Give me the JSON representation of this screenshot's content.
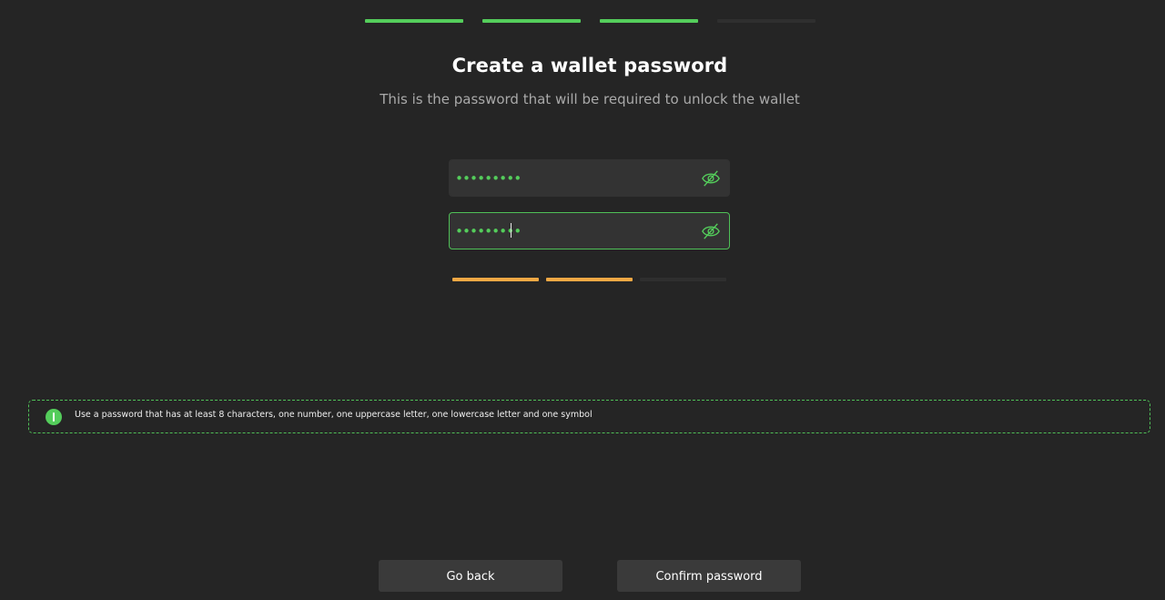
{
  "stepper": {
    "steps": [
      {
        "state": "done"
      },
      {
        "state": "done"
      },
      {
        "state": "done"
      },
      {
        "state": "pending"
      }
    ]
  },
  "header": {
    "title": "Create a wallet password",
    "subtitle": "This is the password that will be required to unlock the wallet"
  },
  "form": {
    "password": {
      "value": "•••••••••",
      "visibility_icon": "eye-off-icon"
    },
    "confirm_password": {
      "value": "•••••••••",
      "visibility_icon": "eye-off-icon"
    },
    "strength": {
      "filled_segments": 2,
      "total_segments": 3,
      "color": "#f3a844"
    }
  },
  "hint": {
    "icon": "info-icon",
    "text": "Use a password that has at least 8 characters, one number, one uppercase letter, one lowercase letter and one symbol"
  },
  "actions": {
    "back_label": "Go back",
    "confirm_label": "Confirm password"
  },
  "colors": {
    "accent": "#54cd5b",
    "background": "#252525",
    "warning": "#f3a844"
  }
}
